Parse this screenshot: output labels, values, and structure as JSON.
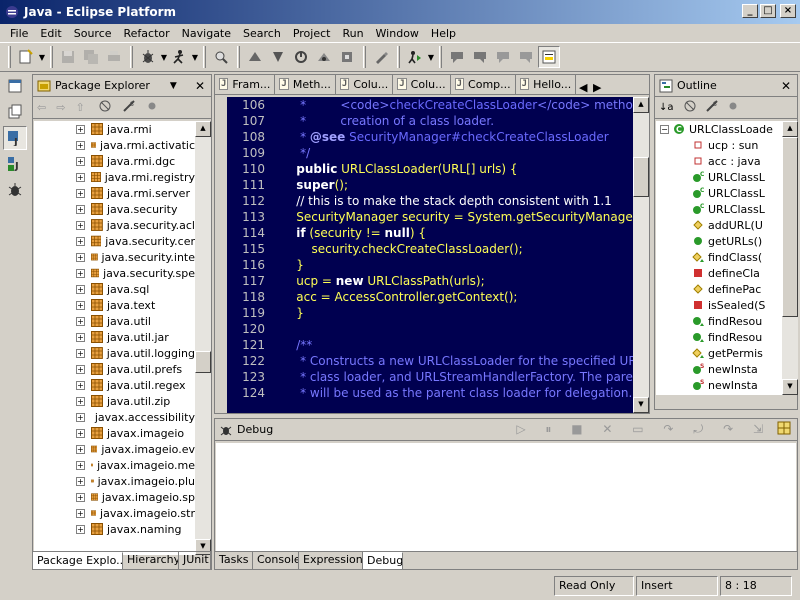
{
  "window": {
    "title": "Java - Eclipse Platform"
  },
  "menubar": {
    "items": [
      "File",
      "Edit",
      "Source",
      "Refactor",
      "Navigate",
      "Search",
      "Project",
      "Run",
      "Window",
      "Help"
    ]
  },
  "package_explorer": {
    "title": "Package Explorer",
    "packages": [
      "java.rmi",
      "java.rmi.activatic",
      "java.rmi.dgc",
      "java.rmi.registry",
      "java.rmi.server",
      "java.security",
      "java.security.acl",
      "java.security.cer",
      "java.security.inte",
      "java.security.spe",
      "java.sql",
      "java.text",
      "java.util",
      "java.util.jar",
      "java.util.logging",
      "java.util.prefs",
      "java.util.regex",
      "java.util.zip",
      "javax.accessibility",
      "javax.imageio",
      "javax.imageio.ev",
      "javax.imageio.me",
      "javax.imageio.plu",
      "javax.imageio.sp",
      "javax.imageio.str",
      "javax.naming"
    ],
    "tabs": [
      "Package Explo...",
      "Hierarchy",
      "JUnit"
    ]
  },
  "editor": {
    "tabs": [
      "Fram...",
      "Meth...",
      "Colu...",
      "Colu...",
      "Comp...",
      "Hello..."
    ],
    "lines": [
      {
        "num": "106",
        "parts": [
          {
            "t": "     *         ",
            "c": "jd"
          },
          {
            "t": "<code>",
            "c": "jd"
          },
          {
            "t": "checkCreateClassLoader",
            "c": "cm"
          },
          {
            "t": "</code> method",
            "c": "jd"
          }
        ]
      },
      {
        "num": "107",
        "parts": [
          {
            "t": "     *         creation of a class loader.",
            "c": "jd"
          }
        ]
      },
      {
        "num": "108",
        "parts": [
          {
            "t": "     * ",
            "c": "jd"
          },
          {
            "t": "@see",
            "c": "jdtag"
          },
          {
            "t": " SecurityManager#checkCreateClassLoader",
            "c": "cm"
          }
        ]
      },
      {
        "num": "109",
        "parts": [
          {
            "t": "     */",
            "c": "jd"
          }
        ]
      },
      {
        "num": "110",
        "parts": [
          {
            "t": "    ",
            "c": "code"
          },
          {
            "t": "public",
            "c": "kw"
          },
          {
            "t": " URLClassLoader(URL[] urls) {",
            "c": "ident"
          }
        ]
      },
      {
        "num": "111",
        "parts": [
          {
            "t": "    ",
            "c": "code"
          },
          {
            "t": "super",
            "c": "kw"
          },
          {
            "t": "();",
            "c": "ident"
          }
        ]
      },
      {
        "num": "112",
        "parts": [
          {
            "t": "    // this is to make the stack depth consistent with 1.1",
            "c": "code"
          }
        ]
      },
      {
        "num": "113",
        "parts": [
          {
            "t": "    SecurityManager security = System.getSecurityManager();",
            "c": "ident"
          }
        ]
      },
      {
        "num": "114",
        "parts": [
          {
            "t": "    ",
            "c": "code"
          },
          {
            "t": "if",
            "c": "kw"
          },
          {
            "t": " (security != ",
            "c": "ident"
          },
          {
            "t": "null",
            "c": "kw"
          },
          {
            "t": ") {",
            "c": "ident"
          }
        ]
      },
      {
        "num": "115",
        "parts": [
          {
            "t": "        security.checkCreateClassLoader();",
            "c": "ident"
          }
        ]
      },
      {
        "num": "116",
        "parts": [
          {
            "t": "    }",
            "c": "ident"
          }
        ]
      },
      {
        "num": "117",
        "parts": [
          {
            "t": "    ucp = ",
            "c": "ident"
          },
          {
            "t": "new",
            "c": "kw"
          },
          {
            "t": " URLClassPath(urls);",
            "c": "ident"
          }
        ]
      },
      {
        "num": "118",
        "parts": [
          {
            "t": "    acc = AccessController.getContext();",
            "c": "ident"
          }
        ]
      },
      {
        "num": "119",
        "parts": [
          {
            "t": "    }",
            "c": "ident"
          }
        ]
      },
      {
        "num": "120",
        "parts": [
          {
            "t": "",
            "c": "code"
          }
        ]
      },
      {
        "num": "121",
        "parts": [
          {
            "t": "    /**",
            "c": "jd"
          }
        ]
      },
      {
        "num": "122",
        "parts": [
          {
            "t": "     * Constructs a new URLClassLoader for the specified URLs,",
            "c": "jd"
          }
        ]
      },
      {
        "num": "123",
        "parts": [
          {
            "t": "     * class loader, and URLStreamHandlerFactory. The parent a",
            "c": "jd"
          }
        ]
      },
      {
        "num": "124",
        "parts": [
          {
            "t": "     * will be used as the parent class loader for delegation. Th",
            "c": "jd"
          }
        ]
      }
    ]
  },
  "outline": {
    "title": "Outline",
    "items": [
      {
        "label": "URLClassLoade",
        "icon": "class-icon",
        "level": 0
      },
      {
        "label": "ucp : sun",
        "icon": "private-field-icon",
        "level": 1
      },
      {
        "label": "acc : java",
        "icon": "private-field-icon",
        "level": 1
      },
      {
        "label": "URLClassL",
        "icon": "constructor-icon",
        "level": 1
      },
      {
        "label": "URLClassL",
        "icon": "constructor-icon",
        "level": 1
      },
      {
        "label": "URLClassL",
        "icon": "constructor-icon",
        "level": 1
      },
      {
        "label": "addURL(U",
        "icon": "protected-method-icon",
        "level": 1
      },
      {
        "label": "getURLs()",
        "icon": "public-method-icon",
        "level": 1
      },
      {
        "label": "findClass(",
        "icon": "protected-override-method-icon",
        "level": 1
      },
      {
        "label": "defineCla",
        "icon": "private-method-icon",
        "level": 1
      },
      {
        "label": "definePac",
        "icon": "protected-method-icon",
        "level": 1
      },
      {
        "label": "isSealed(S",
        "icon": "private-method-icon",
        "level": 1
      },
      {
        "label": "findResou",
        "icon": "public-override-method-icon",
        "level": 1
      },
      {
        "label": "findResou",
        "icon": "public-override-method-icon",
        "level": 1
      },
      {
        "label": "getPermis",
        "icon": "protected-override-method-icon",
        "level": 1
      },
      {
        "label": "newInsta",
        "icon": "static-method-icon",
        "level": 1
      },
      {
        "label": "newInsta",
        "icon": "static-method-icon",
        "level": 1
      }
    ]
  },
  "debug": {
    "title": "Debug",
    "tabs": [
      "Tasks",
      "Console",
      "Expressions",
      "Debug"
    ]
  },
  "statusbar": {
    "mode": "Read Only",
    "insert": "Insert",
    "position": "8 : 18"
  },
  "colors": {
    "editor_bg": "#000050",
    "title_start": "#0a246a",
    "title_end": "#a6caf0",
    "chrome": "#d4d0c8"
  }
}
